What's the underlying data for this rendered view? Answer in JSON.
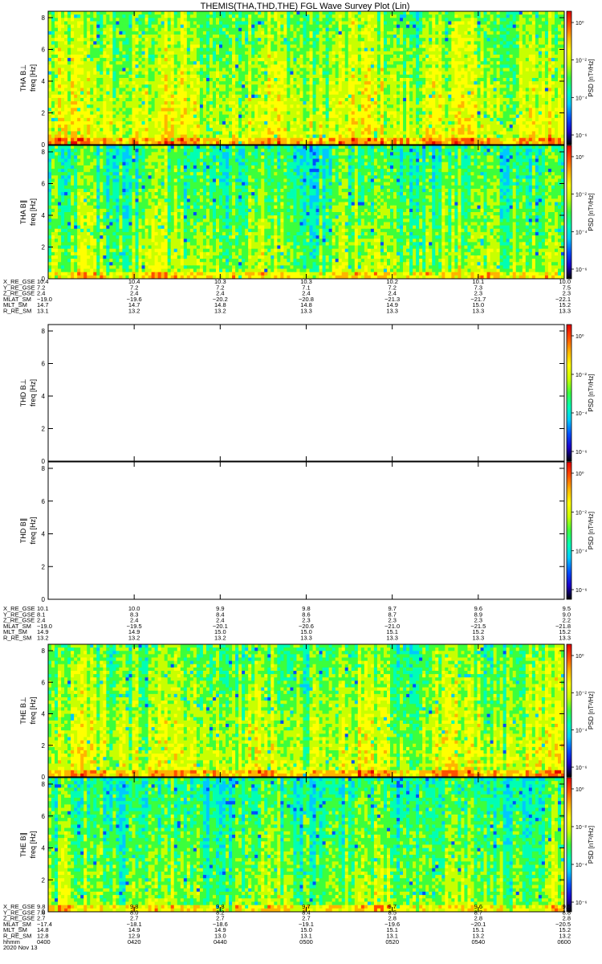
{
  "title": "THEMIS(THA,THD,THE) FGL Wave Survey Plot (Lin)",
  "chart_data": {
    "type": "heatmap",
    "freq_range_hz": [
      0,
      8
    ],
    "y_ticks": [
      "0",
      "2",
      "4",
      "6",
      "8"
    ],
    "colorbar": {
      "label": "PSD [nT²/Hz]",
      "ticks": [
        "10⁰",
        "10⁻²",
        "10⁻⁴",
        "10⁻⁶"
      ],
      "scale": "log",
      "colors": [
        "#000000",
        "#1a00c8",
        "#0050ff",
        "#00c8ff",
        "#00ffb4",
        "#3cff3c",
        "#c8ff00",
        "#ffff00",
        "#ffb400",
        "#ff5000",
        "#e60000"
      ]
    },
    "panels": [
      {
        "id": "tha-bl",
        "ylabel": "freq [Hz]",
        "side_label": "THA B⊥",
        "has_data": true,
        "level": 0.58
      },
      {
        "id": "tha-bpar",
        "ylabel": "freq [Hz]",
        "side_label": "THA B∥",
        "has_data": true,
        "level": 0.47
      },
      {
        "id": "thd-bl",
        "ylabel": "freq [Hz]",
        "side_label": "THD B⊥",
        "has_data": false,
        "level": 0
      },
      {
        "id": "thd-bpar",
        "ylabel": "freq [Hz]",
        "side_label": "THD B∥",
        "has_data": false,
        "level": 0
      },
      {
        "id": "the-bl",
        "ylabel": "freq [Hz]",
        "side_label": "THE B⊥",
        "has_data": true,
        "level": 0.55
      },
      {
        "id": "the-bpar",
        "ylabel": "freq [Hz]",
        "side_label": "THE B∥",
        "has_data": true,
        "level": 0.45
      }
    ],
    "ephemeris_blocks": [
      {
        "labels": [
          "X_RE_GSE",
          "Y_RE_GSE",
          "Z_RE_GSE",
          "MLAT_SM",
          "MLT_SM",
          "R_RE_SM"
        ],
        "columns": [
          [
            "10.4",
            "7.2",
            "2.4",
            "−19.0",
            "14.7",
            "13.1"
          ],
          [
            "10.4",
            "7.2",
            "2.4",
            "−19.6",
            "14.7",
            "13.2"
          ],
          [
            "10.3",
            "7.2",
            "2.4",
            "−20.2",
            "14.8",
            "13.2"
          ],
          [
            "10.3",
            "7.1",
            "2.4",
            "−20.8",
            "14.8",
            "13.3"
          ],
          [
            "10.2",
            "7.2",
            "2.4",
            "−21.3",
            "14.9",
            "13.3"
          ],
          [
            "10.1",
            "7.3",
            "2.3",
            "−21.7",
            "15.0",
            "13.3"
          ],
          [
            "10.0",
            "7.5",
            "2.3",
            "−22.1",
            "15.2",
            "13.3"
          ]
        ]
      },
      {
        "labels": [
          "X_RE_GSE",
          "Y_RE_GSE",
          "Z_RE_GSE",
          "MLAT_SM",
          "MLT_SM",
          "R_RE_SM"
        ],
        "columns": [
          [
            "10.1",
            "8.1",
            "2.4",
            "−19.0",
            "14.9",
            "13.2"
          ],
          [
            "10.0",
            "8.3",
            "2.4",
            "−19.5",
            "14.9",
            "13.2"
          ],
          [
            "9.9",
            "8.4",
            "2.4",
            "−20.1",
            "15.0",
            "13.2"
          ],
          [
            "9.8",
            "8.6",
            "2.3",
            "−20.6",
            "15.0",
            "13.3"
          ],
          [
            "9.7",
            "8.7",
            "2.3",
            "−21.0",
            "15.1",
            "13.3"
          ],
          [
            "9.6",
            "8.9",
            "2.3",
            "−21.5",
            "15.2",
            "13.3"
          ],
          [
            "9.5",
            "9.0",
            "2.2",
            "−21.8",
            "15.2",
            "13.3"
          ]
        ]
      },
      {
        "labels": [
          "X_RE_GSE",
          "Y_RE_GSE",
          "Z_RE_GSE",
          "MLAT_SM",
          "MLT_SM",
          "R_RE_SM",
          "hhmm"
        ],
        "columns": [
          [
            "9.8",
            "7.8",
            "2.7",
            "−17.4",
            "14.8",
            "12.8",
            "0400"
          ],
          [
            "9.8",
            "8.0",
            "2.7",
            "−18.1",
            "14.9",
            "12.9",
            "0420"
          ],
          [
            "9.8",
            "8.2",
            "2.7",
            "−18.6",
            "14.9",
            "13.0",
            "0440"
          ],
          [
            "9.7",
            "8.4",
            "2.7",
            "−19.1",
            "15.0",
            "13.1",
            "0500"
          ],
          [
            "9.7",
            "8.5",
            "2.8",
            "−19.6",
            "15.1",
            "13.1",
            "0520"
          ],
          [
            "9.6",
            "8.7",
            "2.8",
            "−20.1",
            "15.1",
            "13.2",
            "0540"
          ],
          [
            "9.5",
            "8.8",
            "2.8",
            "−20.5",
            "15.2",
            "13.2",
            "0600"
          ]
        ],
        "date": "2020 Nov 13"
      }
    ]
  }
}
